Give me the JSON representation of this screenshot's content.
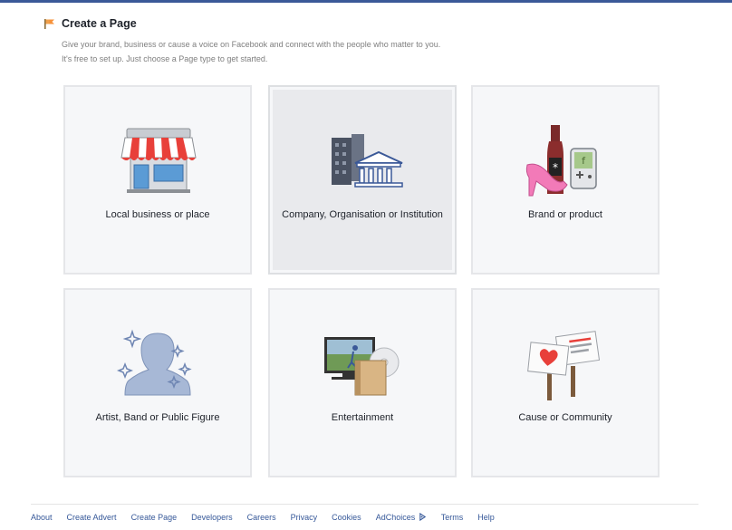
{
  "header": {
    "title": "Create a Page",
    "description": "Give your brand, business or cause a voice on Facebook and connect with the people who matter to you.",
    "subtext": "It's free to set up. Just choose a Page type to get started."
  },
  "tiles": [
    {
      "label": "Local business or place",
      "icon": "storefront-icon"
    },
    {
      "label": "Company, Organisation or Institution",
      "icon": "company-building-icon"
    },
    {
      "label": "Brand or product",
      "icon": "brand-products-icon"
    },
    {
      "label": "Artist, Band or Public Figure",
      "icon": "public-figure-icon"
    },
    {
      "label": "Entertainment",
      "icon": "entertainment-icon"
    },
    {
      "label": "Cause or Community",
      "icon": "cause-signs-icon"
    }
  ],
  "footer": {
    "links": [
      "About",
      "Create Advert",
      "Create Page",
      "Developers",
      "Careers",
      "Privacy",
      "Cookies",
      "AdChoices",
      "Terms",
      "Help"
    ]
  },
  "colors": {
    "brand_bar": "#3b5998",
    "link": "#365899",
    "tile_bg": "#f6f7f9",
    "tile_hover_bg": "#e9eaed"
  }
}
